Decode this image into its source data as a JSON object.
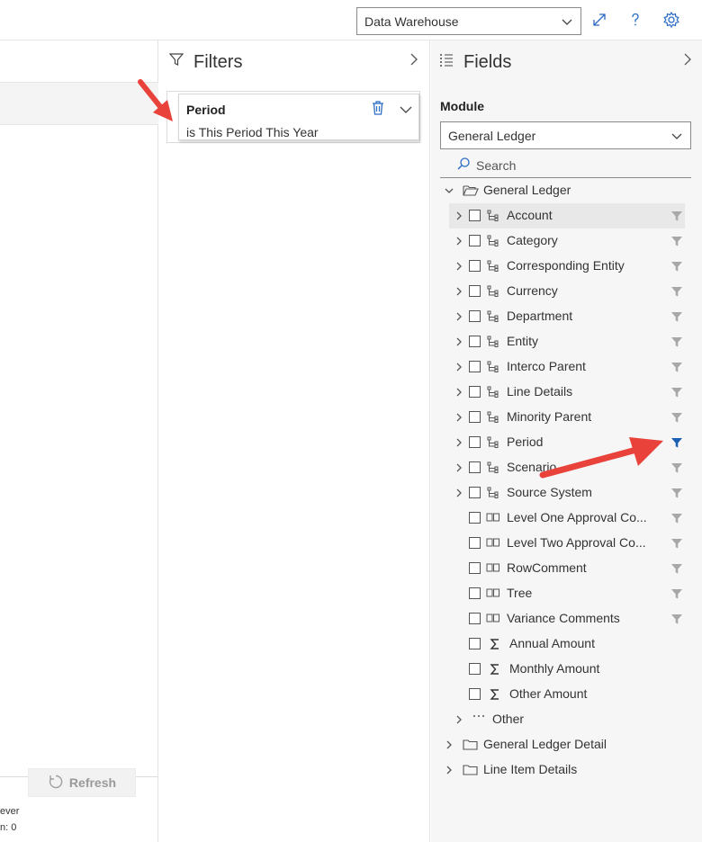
{
  "topbar": {
    "datasource_value": "Data Warehouse",
    "icons": [
      "expand-icon",
      "help-icon",
      "settings-icon"
    ]
  },
  "left": {
    "footer_line1": "ever",
    "footer_line2": "n: 0",
    "refresh_label": "Refresh"
  },
  "filters": {
    "title": "Filters",
    "card": {
      "title": "Period",
      "value": "is This Period This Year"
    }
  },
  "fields": {
    "title": "Fields",
    "module_label": "Module",
    "module_value": "General Ledger",
    "search_placeholder": "Search",
    "tree": {
      "root": "General Ledger",
      "hierarchies": [
        "Account",
        "Category",
        "Corresponding Entity",
        "Currency",
        "Department",
        "Entity",
        "Interco Parent",
        "Line Details",
        "Minority Parent",
        "Period",
        "Scenario",
        "Source System"
      ],
      "attributes": [
        "Level One Approval Co...",
        "Level Two Approval Co...",
        "RowComment",
        "Tree",
        "Variance Comments"
      ],
      "measures": [
        "Annual Amount",
        "Monthly Amount",
        "Other Amount"
      ],
      "other": "Other",
      "folders": [
        "General Ledger Detail",
        "Line Item Details"
      ],
      "active_filter": "Period"
    }
  },
  "colors": {
    "accent": "#1a5fb4",
    "arrow": "#e8423a",
    "funnel_inactive": "#a8a8a8"
  }
}
